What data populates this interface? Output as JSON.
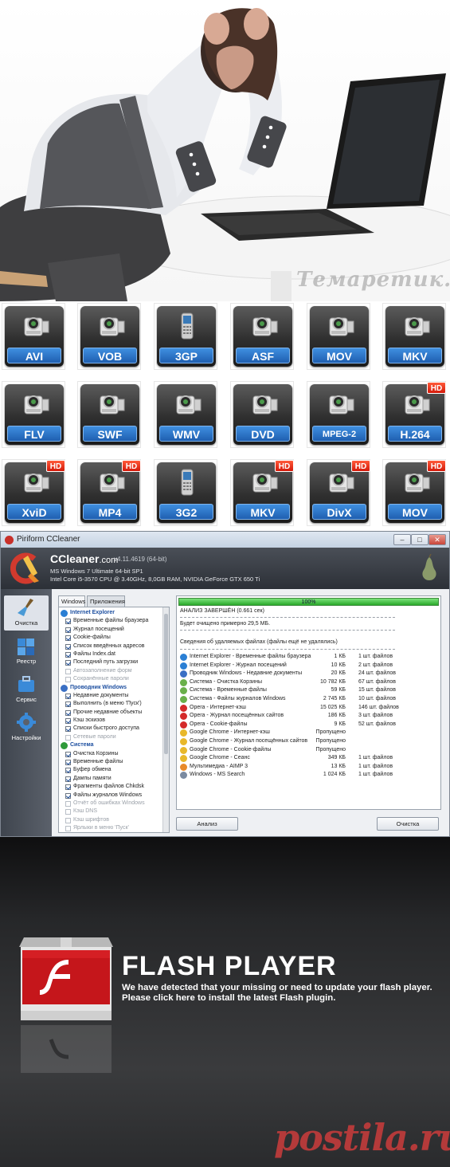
{
  "photo": {
    "watermark": "Темаретик.COM"
  },
  "formats": [
    {
      "label": "AVI",
      "hd": false,
      "icon": "camcorder-icon"
    },
    {
      "label": "VOB",
      "hd": false,
      "icon": "camcorder-icon"
    },
    {
      "label": "3GP",
      "hd": false,
      "icon": "phone-icon"
    },
    {
      "label": "ASF",
      "hd": false,
      "icon": "camcorder-icon"
    },
    {
      "label": "MOV",
      "hd": false,
      "icon": "camcorder-icon"
    },
    {
      "label": "MKV",
      "hd": false,
      "icon": "camcorder-icon"
    },
    {
      "label": "FLV",
      "hd": false,
      "icon": "camcorder-icon"
    },
    {
      "label": "SWF",
      "hd": false,
      "icon": "camcorder-icon"
    },
    {
      "label": "WMV",
      "hd": false,
      "icon": "camcorder-icon"
    },
    {
      "label": "DVD",
      "hd": false,
      "icon": "camcorder-icon"
    },
    {
      "label": "MPEG-2",
      "hd": false,
      "icon": "camcorder-icon"
    },
    {
      "label": "H.264",
      "hd": true,
      "icon": "camcorder-icon"
    },
    {
      "label": "XviD",
      "hd": true,
      "icon": "camcorder-icon"
    },
    {
      "label": "MP4",
      "hd": true,
      "icon": "camcorder-icon"
    },
    {
      "label": "3G2",
      "hd": false,
      "icon": "phone-icon"
    },
    {
      "label": "MKV",
      "hd": true,
      "icon": "camcorder-icon"
    },
    {
      "label": "DivX",
      "hd": true,
      "icon": "camcorder-icon"
    },
    {
      "label": "MOV",
      "hd": true,
      "icon": "camcorder-icon"
    }
  ],
  "hd_badge": "HD",
  "ccleaner": {
    "window_title": "Piriform CCleaner",
    "window_buttons": [
      "–",
      "□",
      "✕"
    ],
    "brand": "CCleaner",
    "brand_domain": ".com",
    "version": "v4.11.4619 (64-bit)",
    "sys_line1": "MS Windows 7 Ultimate 64-bit SP1",
    "sys_line2": "Intel Core i5-3570 CPU @ 3.40GHz, 8,0GB RAM, NVIDIA GeForce GTX 650 Ti",
    "sidebar": [
      {
        "label": "Очистка",
        "icon": "broom-icon",
        "active": true
      },
      {
        "label": "Реестр",
        "icon": "registry-cubes-icon",
        "active": false
      },
      {
        "label": "Сервис",
        "icon": "toolbox-icon",
        "active": false
      },
      {
        "label": "Настройки",
        "icon": "gear-icon",
        "active": false
      }
    ],
    "tabs": [
      "Windows",
      "Приложения"
    ],
    "tree": [
      {
        "type": "cat",
        "label": "Internet Explorer",
        "color": "#2a7fd4"
      },
      {
        "type": "item",
        "label": "Временные файлы браузера",
        "checked": true
      },
      {
        "type": "item",
        "label": "Журнал посещений",
        "checked": true
      },
      {
        "type": "item",
        "label": "Cookie-файлы",
        "checked": true
      },
      {
        "type": "item",
        "label": "Список введённых адресов",
        "checked": true
      },
      {
        "type": "item",
        "label": "Файлы Index.dat",
        "checked": true
      },
      {
        "type": "item",
        "label": "Последний путь загрузки",
        "checked": true
      },
      {
        "type": "item",
        "label": "Автозаполнение форм",
        "checked": false
      },
      {
        "type": "item",
        "label": "Сохранённые пароли",
        "checked": false
      },
      {
        "type": "cat",
        "label": "Проводник Windows",
        "color": "#3a6fc4"
      },
      {
        "type": "item",
        "label": "Недавние документы",
        "checked": true
      },
      {
        "type": "item",
        "label": "Выполнить (в меню 'Пуск')",
        "checked": true
      },
      {
        "type": "item",
        "label": "Прочие недавние объекты",
        "checked": true
      },
      {
        "type": "item",
        "label": "Кэш эскизов",
        "checked": true
      },
      {
        "type": "item",
        "label": "Списки быстрого доступа",
        "checked": true
      },
      {
        "type": "item",
        "label": "Сетевые пароли",
        "checked": false
      },
      {
        "type": "cat",
        "label": "Система",
        "color": "#2f9a3a"
      },
      {
        "type": "item",
        "label": "Очистка Корзины",
        "checked": true
      },
      {
        "type": "item",
        "label": "Временные файлы",
        "checked": true
      },
      {
        "type": "item",
        "label": "Буфер обмена",
        "checked": true
      },
      {
        "type": "item",
        "label": "Дампы памяти",
        "checked": true
      },
      {
        "type": "item",
        "label": "Фрагменты файлов Chkdsk",
        "checked": true
      },
      {
        "type": "item",
        "label": "Файлы журналов Windows",
        "checked": true
      },
      {
        "type": "item",
        "label": "Отчёт об ошибках Windows",
        "checked": false
      },
      {
        "type": "item",
        "label": "Кэш DNS",
        "checked": false
      },
      {
        "type": "item",
        "label": "Кэш шрифтов",
        "checked": false
      },
      {
        "type": "item",
        "label": "Ярлыки в меню 'Пуск'",
        "checked": false
      }
    ],
    "progress_label": "100%",
    "progress_value": 1.0,
    "analysis_done": "АНАЛИЗ ЗАВЕРШЁН (0.661 сек)",
    "will_clean": "Будет очищено примерно 29,5 МБ.",
    "details_title": "Сведения об удаляемых файлах (файлы ещё не удалялись)",
    "results": [
      {
        "name": "Internet Explorer - Временные файлы браузера",
        "size": "1 КБ",
        "count": "1 шт. файлов",
        "icon": "ie-icon"
      },
      {
        "name": "Internet Explorer - Журнал посещений",
        "size": "10 КБ",
        "count": "2 шт. файлов",
        "icon": "ie-icon"
      },
      {
        "name": "Проводник Windows - Недавние документы",
        "size": "20 КБ",
        "count": "24 шт. файлов",
        "icon": "explorer-icon"
      },
      {
        "name": "Система - Очистка Корзины",
        "size": "10 782 КБ",
        "count": "67 шт. файлов",
        "icon": "windows-icon"
      },
      {
        "name": "Система - Временные файлы",
        "size": "59 КБ",
        "count": "15 шт. файлов",
        "icon": "windows-icon"
      },
      {
        "name": "Система - Файлы журналов Windows",
        "size": "2 745 КБ",
        "count": "10 шт. файлов",
        "icon": "windows-icon"
      },
      {
        "name": "Opera - Интернет-кэш",
        "size": "15 025 КБ",
        "count": "146 шт. файлов",
        "icon": "opera-icon"
      },
      {
        "name": "Opera - Журнал посещённых сайтов",
        "size": "186 КБ",
        "count": "3 шт. файлов",
        "icon": "opera-icon"
      },
      {
        "name": "Opera - Cookie-файлы",
        "size": "9 КБ",
        "count": "52 шт. файлов",
        "icon": "opera-icon"
      },
      {
        "name": "Google Chrome - Интернет-кэш",
        "size": "Пропущено",
        "count": "",
        "icon": "chrome-icon"
      },
      {
        "name": "Google Chrome - Журнал посещённых сайтов",
        "size": "Пропущено",
        "count": "",
        "icon": "chrome-icon"
      },
      {
        "name": "Google Chrome - Cookie-файлы",
        "size": "Пропущено",
        "count": "",
        "icon": "chrome-icon"
      },
      {
        "name": "Google Chrome - Сеанс",
        "size": "349 КБ",
        "count": "1 шт. файлов",
        "icon": "chrome-icon"
      },
      {
        "name": "Мультимедиа - AIMP 3",
        "size": "13 КБ",
        "count": "1 шт. файлов",
        "icon": "aimp-icon"
      },
      {
        "name": "Windows - MS Search",
        "size": "1 024 КБ",
        "count": "1 шт. файлов",
        "icon": "search-index-icon"
      }
    ],
    "analyze_button": "Анализ",
    "clean_button": "Очистка"
  },
  "flash": {
    "title": "FLASH PLAYER",
    "message_line1": "We have detected that your missing or need to update your flash player.",
    "message_line2": "Please click here to install the latest Flash plugin.",
    "watermark": "postila.ru"
  }
}
